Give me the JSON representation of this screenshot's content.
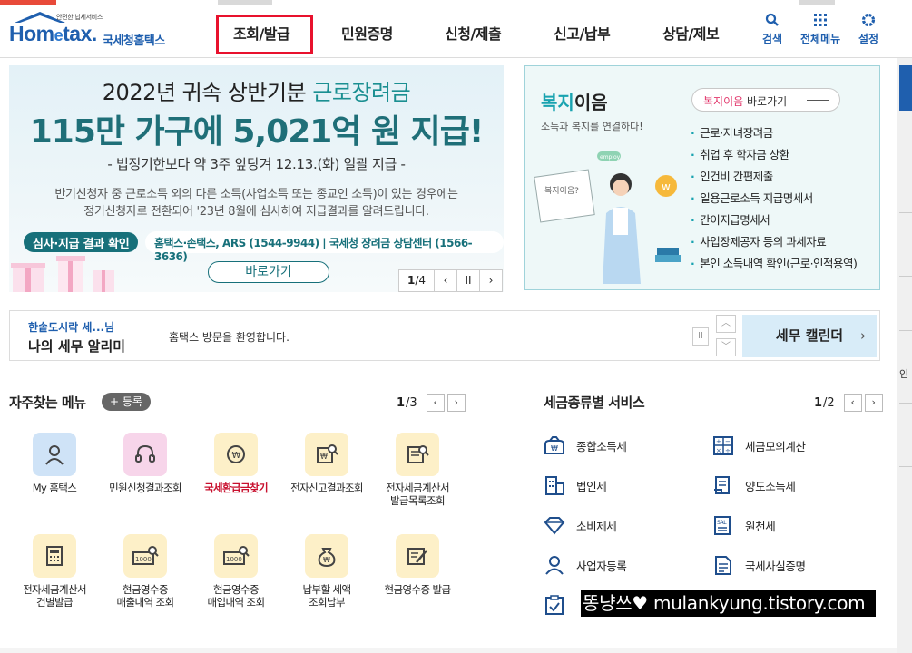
{
  "header": {
    "logo_small": "안전한 납세서비스",
    "logo_main_a": "Hom",
    "logo_main_e": "e",
    "logo_main_b": "tax.",
    "logo_sub": "국세청홈택스",
    "nav": [
      "조회/발급",
      "민원증명",
      "신청/제출",
      "신고/납부",
      "상담/제보"
    ],
    "util": {
      "search": "검색",
      "all_menu": "전체메뉴",
      "settings": "설정"
    }
  },
  "banner": {
    "line1_a": "2022년 귀속 상반기분 ",
    "line1_b": "근로장려금",
    "line2": "115만 가구에 5,021억 원 지급!",
    "line3": "- 법정기한보다 약 3주 앞당겨 12.13.(화) 일괄 지급 -",
    "line4_a": "반기신청자 중 근로소득 외의 다른 소득(사업소득 또는 종교인 소득)이 있는 경우에는",
    "line4_b": "정기신청자로 전환되어 '23년 8월에 심사하여 지급결과를 알려드립니다.",
    "pill": "심사·지급 결과 확인",
    "contact": "홈택스·손택스, ARS (1544-9944) | 국세청 장려금 상담센터 (1566-3636)",
    "go_button": "바로가기",
    "pager_current": "1",
    "pager_total": "/4",
    "prev": "‹",
    "pause": "II",
    "next": "›"
  },
  "welfare": {
    "title_a": "복지",
    "title_b": "이음",
    "subtitle": "소득과 복지를 연결하다!",
    "btn_a": "복지이음",
    "btn_b": " 바로가기",
    "items": [
      "근로·자녀장려금",
      "취업 후 학자금 상환",
      "인건비 간편제출",
      "일용근로소득 지급명세서",
      "간이지급명세서",
      "사업장제공자 등의 과세자료",
      "본인 소득내역 확인(근로·인적용역)"
    ],
    "illus_sign": "복지이음?",
    "illus_tag": "employ"
  },
  "notice": {
    "user": "한솥도시락 세...님",
    "title": "나의 세무 알리미",
    "message": "홈택스 방문을 환영합니다.",
    "pause": "II",
    "up": "︿",
    "down": "﹀",
    "calendar": "세무 캘린더",
    "calendar_arrow": "›"
  },
  "favorites": {
    "title": "자주찾는 메뉴",
    "register": "+ 등록",
    "page_current": "1",
    "page_total": "/3",
    "prev": "‹",
    "next": "›",
    "items": [
      {
        "label": "My 홈택스",
        "icon": "person-icon",
        "bg": "#cfe3f7"
      },
      {
        "label": "민원신청결과조회",
        "icon": "headset-icon",
        "bg": "#f7d5ea"
      },
      {
        "label": "국세환급금찾기",
        "icon": "coin-refund-icon",
        "bg": "#fdf0c8"
      },
      {
        "label": "전자신고결과조회",
        "icon": "document-search-icon",
        "bg": "#fdf0c8"
      },
      {
        "label": "전자세금계산서",
        "label2": "발급목록조회",
        "icon": "invoice-search-icon",
        "bg": "#fdf0c8"
      },
      {
        "label": "전자세금계산서",
        "label2": "건별발급",
        "icon": "calculator-icon",
        "bg": "#fdf0c8"
      },
      {
        "label": "현금영수증",
        "label2": "매출내역 조회",
        "icon": "receipt-search-icon",
        "bg": "#fdf0c8"
      },
      {
        "label": "현금영수증",
        "label2": "매입내역 조회",
        "icon": "receipt-search-icon",
        "bg": "#fdf0c8"
      },
      {
        "label": "납부할 세액",
        "label2": "조회납부",
        "icon": "money-bag-icon",
        "bg": "#fdf0c8"
      },
      {
        "label": "현금영수증 발급",
        "icon": "receipt-pen-icon",
        "bg": "#fdf0c8"
      }
    ],
    "money_tag": "1000"
  },
  "tax_services": {
    "title": "세금종류별 서비스",
    "page_current": "1",
    "page_total": "/2",
    "prev": "‹",
    "next": "›",
    "left": [
      "종합소득세",
      "법인세",
      "소비제세",
      "사업자등록",
      ""
    ],
    "right": [
      "세금모의계산",
      "양도소득세",
      "원천세",
      "국세사실증명"
    ],
    "calc_tag": "SAL"
  },
  "watermark": "똥냥쓰♥ mulankyung.tistory.com",
  "sidebar": {
    "char": "인"
  },
  "colors": {
    "brand": "#1f5fae",
    "teal": "#17707a",
    "highlight": "#e8112d"
  }
}
